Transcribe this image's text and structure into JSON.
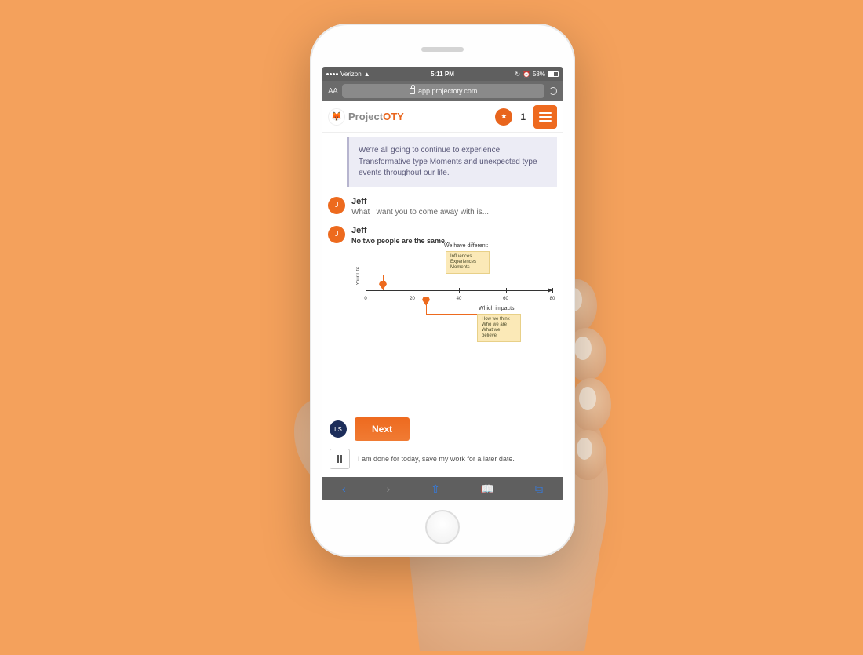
{
  "status": {
    "carrier": "Verizon",
    "time": "5:11 PM",
    "battery_pct": "58%"
  },
  "browser": {
    "text_size_label": "AA",
    "url": "app.projectoty.com"
  },
  "app_header": {
    "brand_pre": "Project",
    "brand_post": "OTY",
    "coin_count": "1"
  },
  "callout": {
    "text": "We're all going to continue to experience Transformative type Moments and unexpected type events throughout our life."
  },
  "messages": [
    {
      "avatar_initial": "J",
      "sender": "Jeff",
      "text": "What I want you to come away with is..."
    },
    {
      "avatar_initial": "J",
      "sender": "Jeff",
      "bold_line": "No two people are the same..."
    }
  ],
  "diagram": {
    "top_title": "We have different:",
    "note1_lines": [
      "Influences",
      "Experiences",
      "Moments"
    ],
    "bottom_title": "Which impacts:",
    "note2_lines": [
      "How we think",
      "Who we are",
      "What we believe"
    ],
    "y_axis_label": "Your Life",
    "ticks": [
      "0",
      "20",
      "40",
      "60",
      "80"
    ]
  },
  "actions": {
    "user_initials": "LS",
    "next_label": "Next",
    "save_text": "I am done for today, save my work for a later date."
  }
}
